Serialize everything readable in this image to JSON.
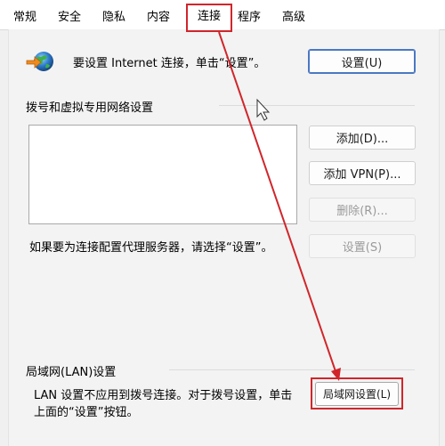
{
  "tabs": [
    {
      "label": "常规",
      "active": false
    },
    {
      "label": "安全",
      "active": false
    },
    {
      "label": "隐私",
      "active": false
    },
    {
      "label": "内容",
      "active": false
    },
    {
      "label": "连接",
      "active": true
    },
    {
      "label": "程序",
      "active": false
    },
    {
      "label": "高级",
      "active": false
    }
  ],
  "setup": {
    "icon": "globe-network-icon",
    "text": "要设置 Internet 连接，单击“设置”。",
    "button_label": "设置(U)"
  },
  "dialup": {
    "group_title": "拨号和虚拟专用网络设置",
    "add_button": "添加(D)...",
    "add_vpn_button": "添加 VPN(P)...",
    "remove_button": "删除(R)...",
    "proxy_text": "如果要为连接配置代理服务器，请选择“设置”。",
    "settings_button": "设置(S)"
  },
  "lan": {
    "group_title": "局域网(LAN)设置",
    "desc_line1": "LAN 设置不应用到拨号连接。对于拨号设置，单击",
    "desc_line2": "上面的“设置”按钮。",
    "button_label": "局域网设置(L)"
  },
  "annotation_color": "#d0262b"
}
